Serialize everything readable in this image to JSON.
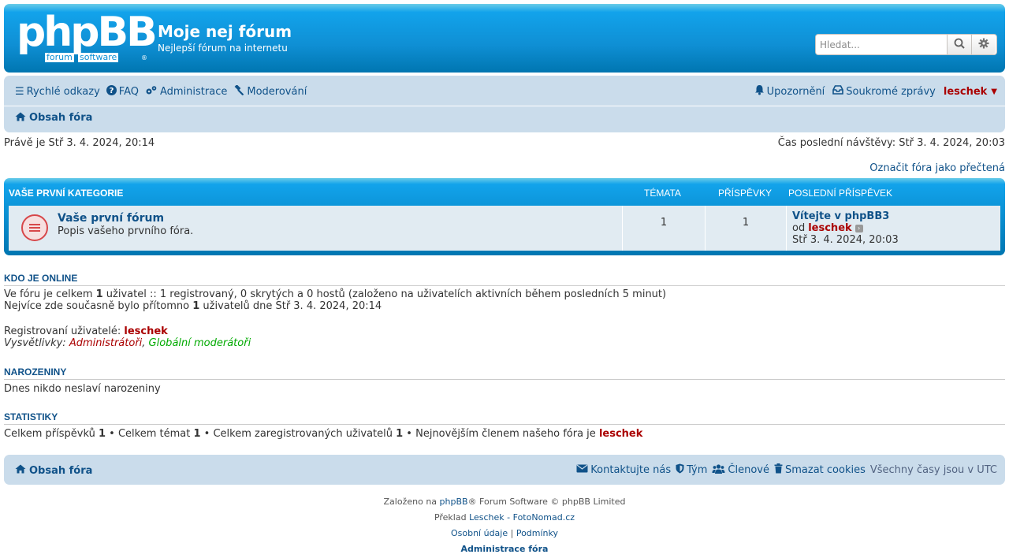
{
  "header": {
    "logo_text": "phpBB",
    "logo_sub1": "forum",
    "logo_sub2": "software",
    "logo_mark": "®",
    "site_title": "Moje nej fórum",
    "site_desc": "Nejlepší fórum na internetu",
    "search_placeholder": "Hledat...",
    "search_icon": "search-icon",
    "settings_icon": "gear-icon"
  },
  "navbar": {
    "quick_links": "Rychlé odkazy",
    "faq": "FAQ",
    "admin": "Administrace",
    "moderate": "Moderování",
    "notifications": "Upozornění",
    "pm": "Soukromé zprávy",
    "username": "leschek",
    "crumb": "Obsah fóra"
  },
  "info": {
    "current_time": "Právě je Stř 3. 4. 2024, 20:14",
    "last_visit": "Čas poslední návštěvy: Stř 3. 4. 2024, 20:03",
    "mark_read": "Označit fóra jako přečtená"
  },
  "category": {
    "title": "VAŠE PRVNÍ KATEGORIE",
    "col_topics": "TÉMATA",
    "col_posts": "PŘÍSPĚVKY",
    "col_last": "POSLEDNÍ PŘÍSPĚVEK",
    "forum": {
      "name": "Vaše první fórum",
      "desc": "Popis vašeho prvního fóra.",
      "topics": "1",
      "posts": "1",
      "last_title": "Vítejte v phpBB3",
      "last_by_prefix": "od",
      "last_user": "leschek",
      "last_date": "Stř 3. 4. 2024, 20:03"
    }
  },
  "online": {
    "title": "KDO JE ONLINE",
    "line1_a": "Ve fóru je celkem ",
    "line1_b": "1",
    "line1_c": " uživatel :: 1 registrovaný, 0 skrytých a 0 hostů (založeno na uživatelích aktivních během posledních 5 minut)",
    "line2_a": "Nejvíce zde současně bylo přítomno ",
    "line2_b": "1",
    "line2_c": " uživatelů dne Stř 3. 4. 2024, 20:14",
    "registered_label": "Registrovaní uživatelé: ",
    "registered_user": "leschek",
    "legend_label": "Vysvětlivky: ",
    "legend_admins": "Administrátoři",
    "legend_sep": ", ",
    "legend_mods": "Globální moderátoři"
  },
  "birthdays": {
    "title": "NAROZENINY",
    "text": "Dnes nikdo neslaví narozeniny"
  },
  "stats": {
    "title": "STATISTIKY",
    "a": "Celkem příspěvků ",
    "b": "1",
    "c": " • Celkem témat ",
    "d": "1",
    "e": " • Celkem zaregistrovaných uživatelů ",
    "f": "1",
    "g": " • Nejnovějším členem našeho fóra je ",
    "user": "leschek"
  },
  "footer": {
    "crumb": "Obsah fóra",
    "contact": "Kontaktujte nás",
    "team": "Tým",
    "members": "Členové",
    "cookies": "Smazat cookies",
    "timezone": "Všechny časy jsou v UTC",
    "powered_a": "Založeno na ",
    "powered_link": "phpBB",
    "powered_b": "® Forum Software © phpBB Limited",
    "translation_a": "Překlad ",
    "translation_link": "Leschek - FotoNomad.cz",
    "privacy": "Osobní údaje",
    "sep": " | ",
    "terms": "Podmínky",
    "acp": "Administrace fóra"
  }
}
